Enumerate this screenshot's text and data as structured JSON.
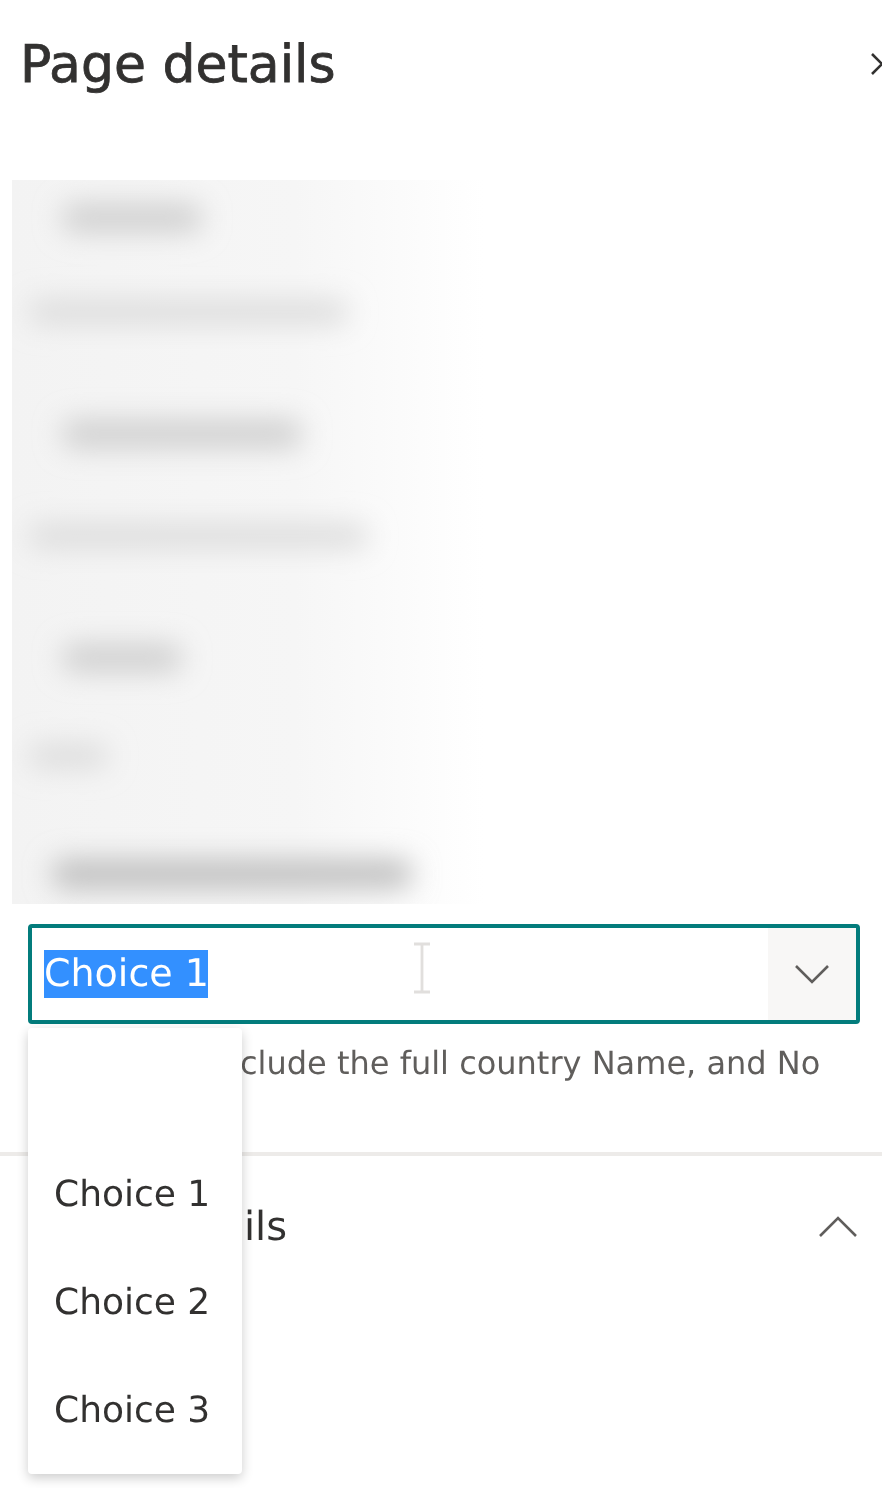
{
  "header": {
    "title": "Page details"
  },
  "choice_field": {
    "value": "Choice 1",
    "text_selected": true,
    "expanded": true
  },
  "hint": "clude the full country Name, and No",
  "dropdown": {
    "options": [
      {
        "label": "Choice 1"
      },
      {
        "label": "Choice 2"
      },
      {
        "label": "Choice 3"
      }
    ]
  },
  "section": {
    "title": "ils",
    "expanded": true
  }
}
